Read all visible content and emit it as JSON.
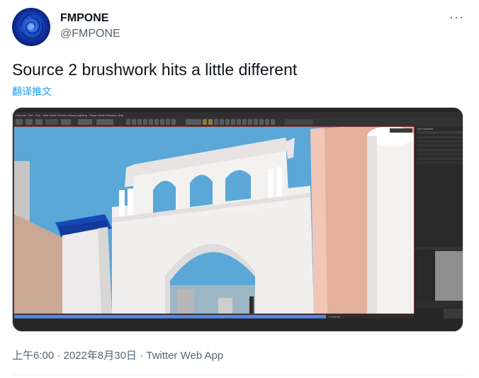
{
  "author": {
    "name": "FMPONE",
    "handle": "@FMPONE",
    "avatar_icon": "blue-rose-avatar"
  },
  "more_icon": "more-horizontal-icon",
  "more_label": "···",
  "tweet": {
    "text": "Source 2 brushwork hits a little different",
    "translate_label": "翻译推文"
  },
  "media": {
    "menu_items": [
      "Hammer",
      "File",
      "Edit",
      "View",
      "Tools",
      "Preview Baked Lighting",
      "Steam Audio",
      "Window",
      "Help"
    ],
    "sidebar_title": "Tool Properties",
    "bottom_status": "0 objects"
  },
  "meta": {
    "text": "上午6:00 · 2022年8月30日 · Twitter Web App"
  },
  "colors": {
    "text_primary": "#0f1419",
    "text_secondary": "#536471",
    "link": "#1d9bf0",
    "sky": "#5aa7d8",
    "wall_pink": "#e4b09c"
  }
}
